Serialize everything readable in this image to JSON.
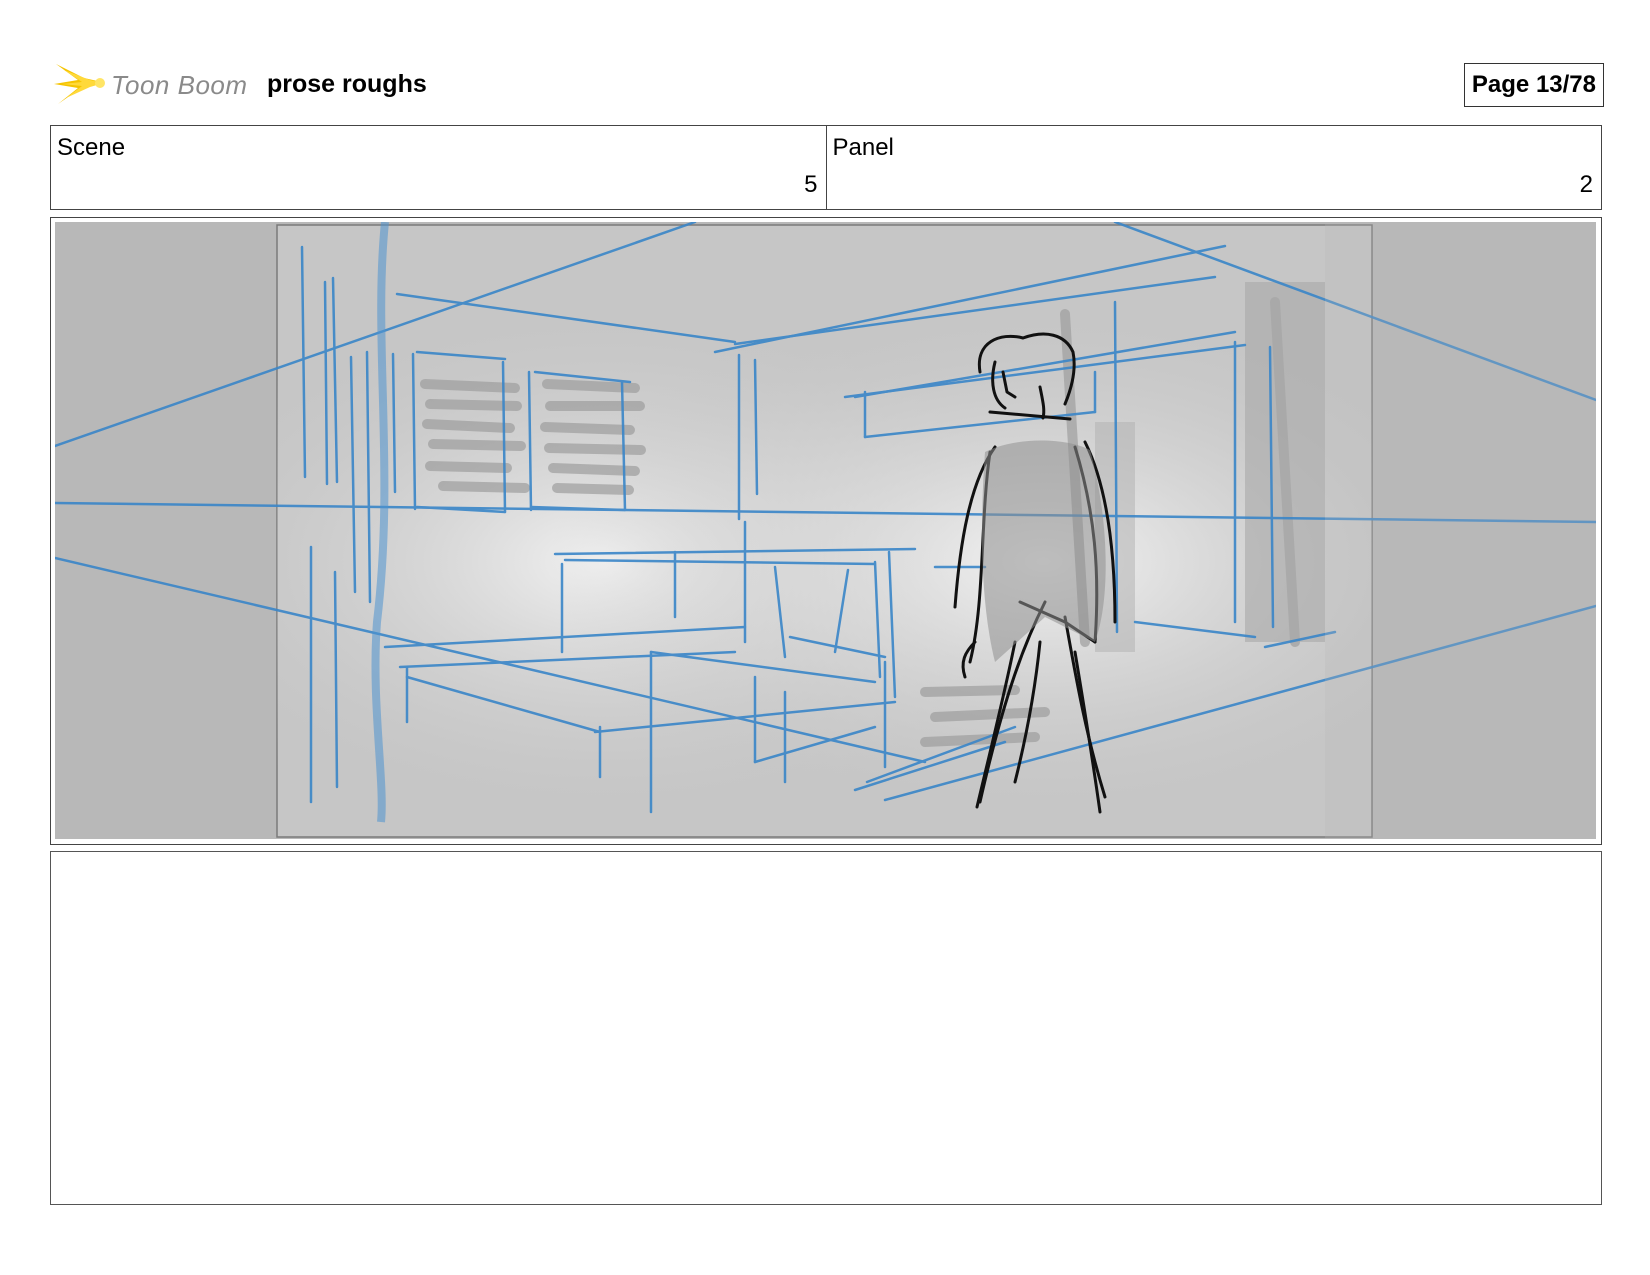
{
  "header": {
    "logo_text": "Toon Boom",
    "project_title": "prose roughs",
    "page_label": "Page 13/78"
  },
  "scene": {
    "label": "Scene",
    "value": "5"
  },
  "panel": {
    "label": "Panel",
    "value": "2"
  },
  "notes": {
    "text": ""
  },
  "colors": {
    "construction_line": "#3a86c8",
    "ink_line": "#111111",
    "background_gray": "#b8b8b8",
    "logo_flare": "#f5c400"
  }
}
